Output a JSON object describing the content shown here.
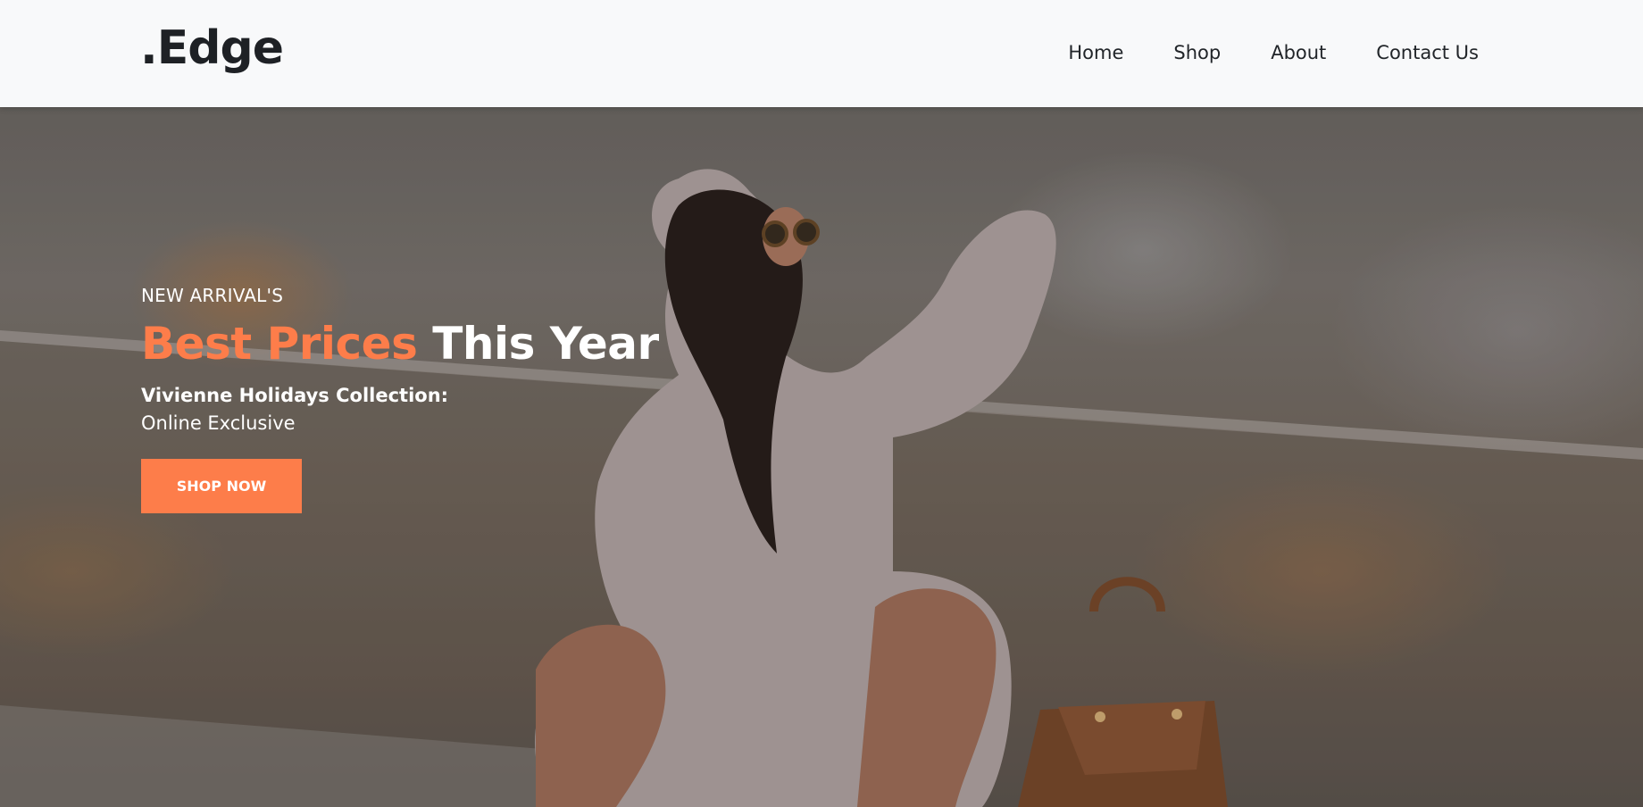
{
  "brand": {
    "name": ".Edge"
  },
  "nav": {
    "items": [
      {
        "label": "Home"
      },
      {
        "label": "Shop"
      },
      {
        "label": "About"
      },
      {
        "label": "Contact Us"
      }
    ]
  },
  "hero": {
    "eyebrow": "NEW ARRIVAL'S",
    "headline_accent": "Best Prices",
    "headline_rest": "This Year",
    "subheading_bold": "Vivienne Holidays Collection:",
    "subheading": "Online Exclusive",
    "cta_label": "SHOP NOW",
    "image": "woman-in-sweater-with-handbag-photo"
  },
  "colors": {
    "accent": "#fd7d4a",
    "navbar_bg": "#f8f9fa",
    "text_dark": "#212529",
    "text_light": "#ffffff"
  }
}
